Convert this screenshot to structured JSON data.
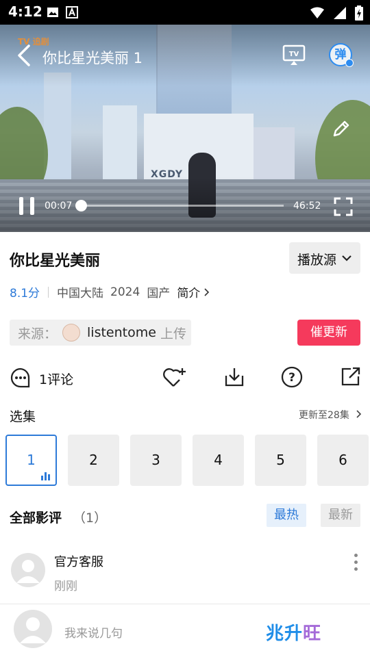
{
  "status_bar": {
    "time": "4:12"
  },
  "player": {
    "watermark": "TV 追剧",
    "title": "你比星光美丽 1",
    "scene_text": "XGDY",
    "danmu_label": "弹",
    "current_time": "00:07",
    "total_time": "46:52",
    "progress_fraction": 0.0025
  },
  "info": {
    "title": "你比星光美丽",
    "source_button": "播放源",
    "score": "8.1分",
    "region": "中国大陆",
    "year": "2024",
    "category": "国产",
    "intro": "简介"
  },
  "uploader": {
    "label": "来源：",
    "name": "listentome",
    "suffix": "上传",
    "urge_button": "催更新"
  },
  "actions": {
    "comment_count": "1评论"
  },
  "episodes": {
    "title": "选集",
    "update": "更新至28集",
    "items": [
      "1",
      "2",
      "3",
      "4",
      "5",
      "6"
    ],
    "active_index": 0
  },
  "reviews": {
    "title": "全部影评",
    "count": "（1）",
    "sort_hot": "最热",
    "sort_new": "最新",
    "items": [
      {
        "name": "官方客服",
        "time": "刚刚"
      }
    ]
  },
  "bottom": {
    "placeholder": "我来说几句",
    "brand_a": "兆升",
    "brand_b": "旺"
  },
  "colors": {
    "accent_blue": "#2d7ad8",
    "urge_red": "#f53a5c"
  }
}
